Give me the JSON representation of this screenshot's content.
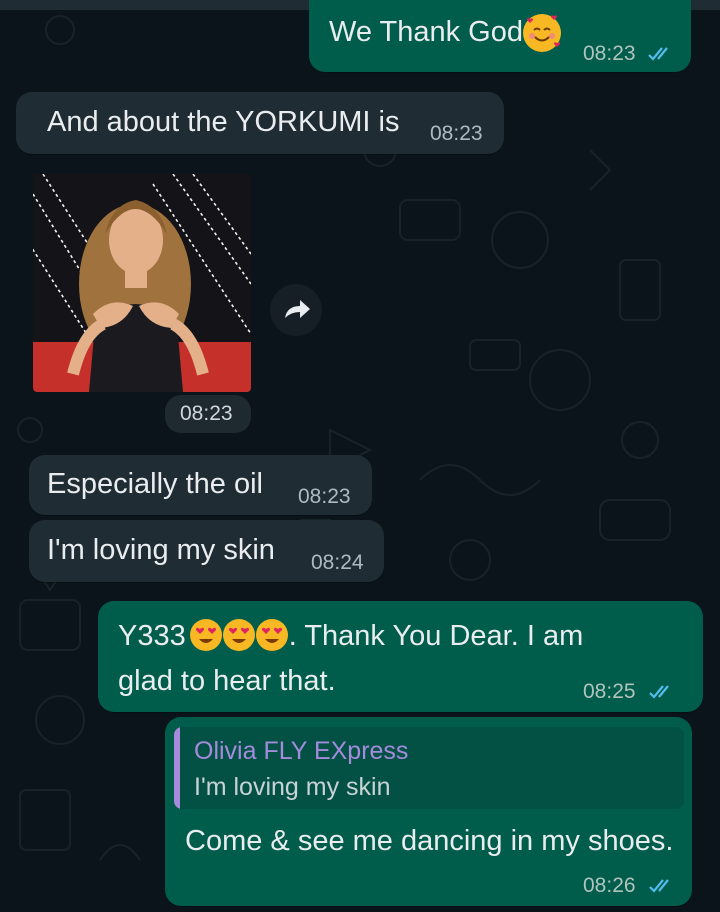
{
  "messages": [
    {
      "text": "We Thank God",
      "time": "08:23"
    },
    {
      "text": "And about the YORKUMI  is",
      "time": "08:23"
    },
    {
      "time": "08:23"
    },
    {
      "text": "Especially the oil",
      "time": "08:23"
    },
    {
      "text": "I'm loving my skin",
      "time": "08:24"
    },
    {
      "prefix": "Y333",
      "line1_rest": ". Thank You Dear. I am",
      "line2": "glad to hear that.",
      "time": "08:25"
    },
    {
      "reply_author": "Olivia FLY EXpress",
      "reply_text": "I'm loving my skin",
      "text": "Come & see me dancing in my shoes.",
      "time": "08:26"
    }
  ],
  "colors": {
    "incoming_bubble": "#202c33",
    "outgoing_bubble": "#005c4b",
    "read_ticks": "#53bdeb",
    "reply_author": "#a48bdc"
  },
  "icons": [
    "smiling-face-with-hearts-icon",
    "heart-eyes-emoji-icon",
    "forward-arrow-icon",
    "read-double-check-icon"
  ]
}
